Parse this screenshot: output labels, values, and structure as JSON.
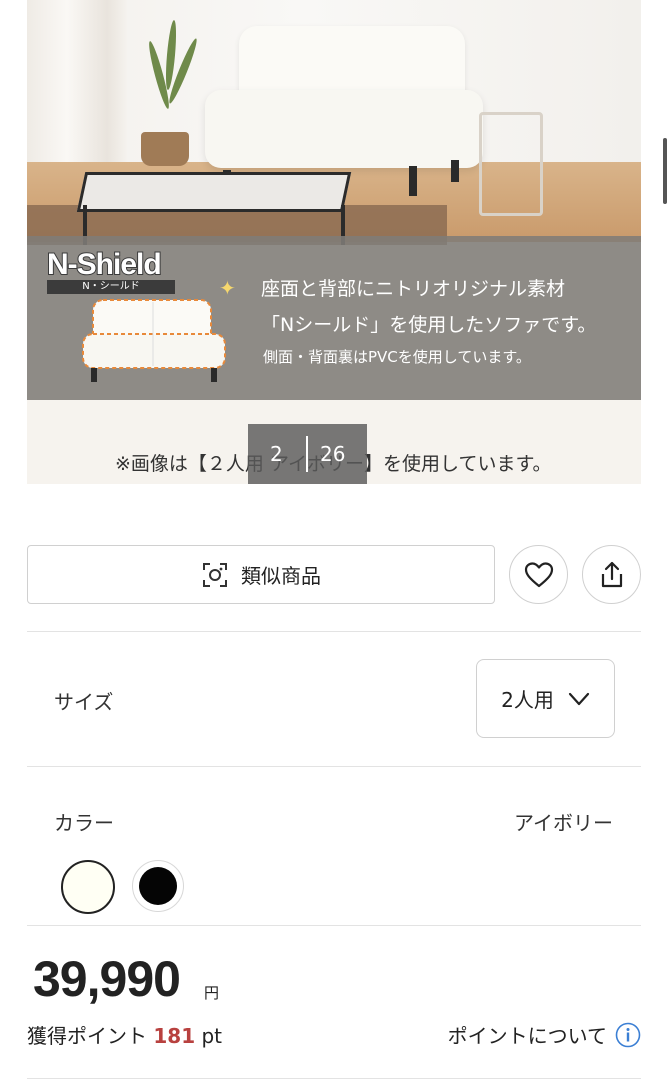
{
  "hero": {
    "logo_text": "N-Shield",
    "logo_sub": "N・シールド",
    "banner_line1": "座面と背部にニトリオリジナル素材",
    "banner_line2": "「Nシールド」を使用したソファです。",
    "banner_line3": "側面・背面裏はPVCを使用しています。",
    "note": "※画像は【２人用 アイボリー】を使用しています。",
    "counter_current": "2",
    "counter_total": "26"
  },
  "actions": {
    "similar_label": "類似商品",
    "similar_icon": "camera-scan-icon",
    "favorite_icon": "heart-icon",
    "share_icon": "share-icon"
  },
  "size": {
    "label": "サイズ",
    "selected": "2人用"
  },
  "color": {
    "label": "カラー",
    "selected": "アイボリー",
    "swatches": [
      "#fffff4",
      "#050505"
    ]
  },
  "price": {
    "amount": "39,990",
    "unit": "円",
    "points_prefix": "獲得ポイント",
    "points_value": "181",
    "points_unit": "pt",
    "points_link": "ポイントについて",
    "info_icon": "info-icon"
  }
}
